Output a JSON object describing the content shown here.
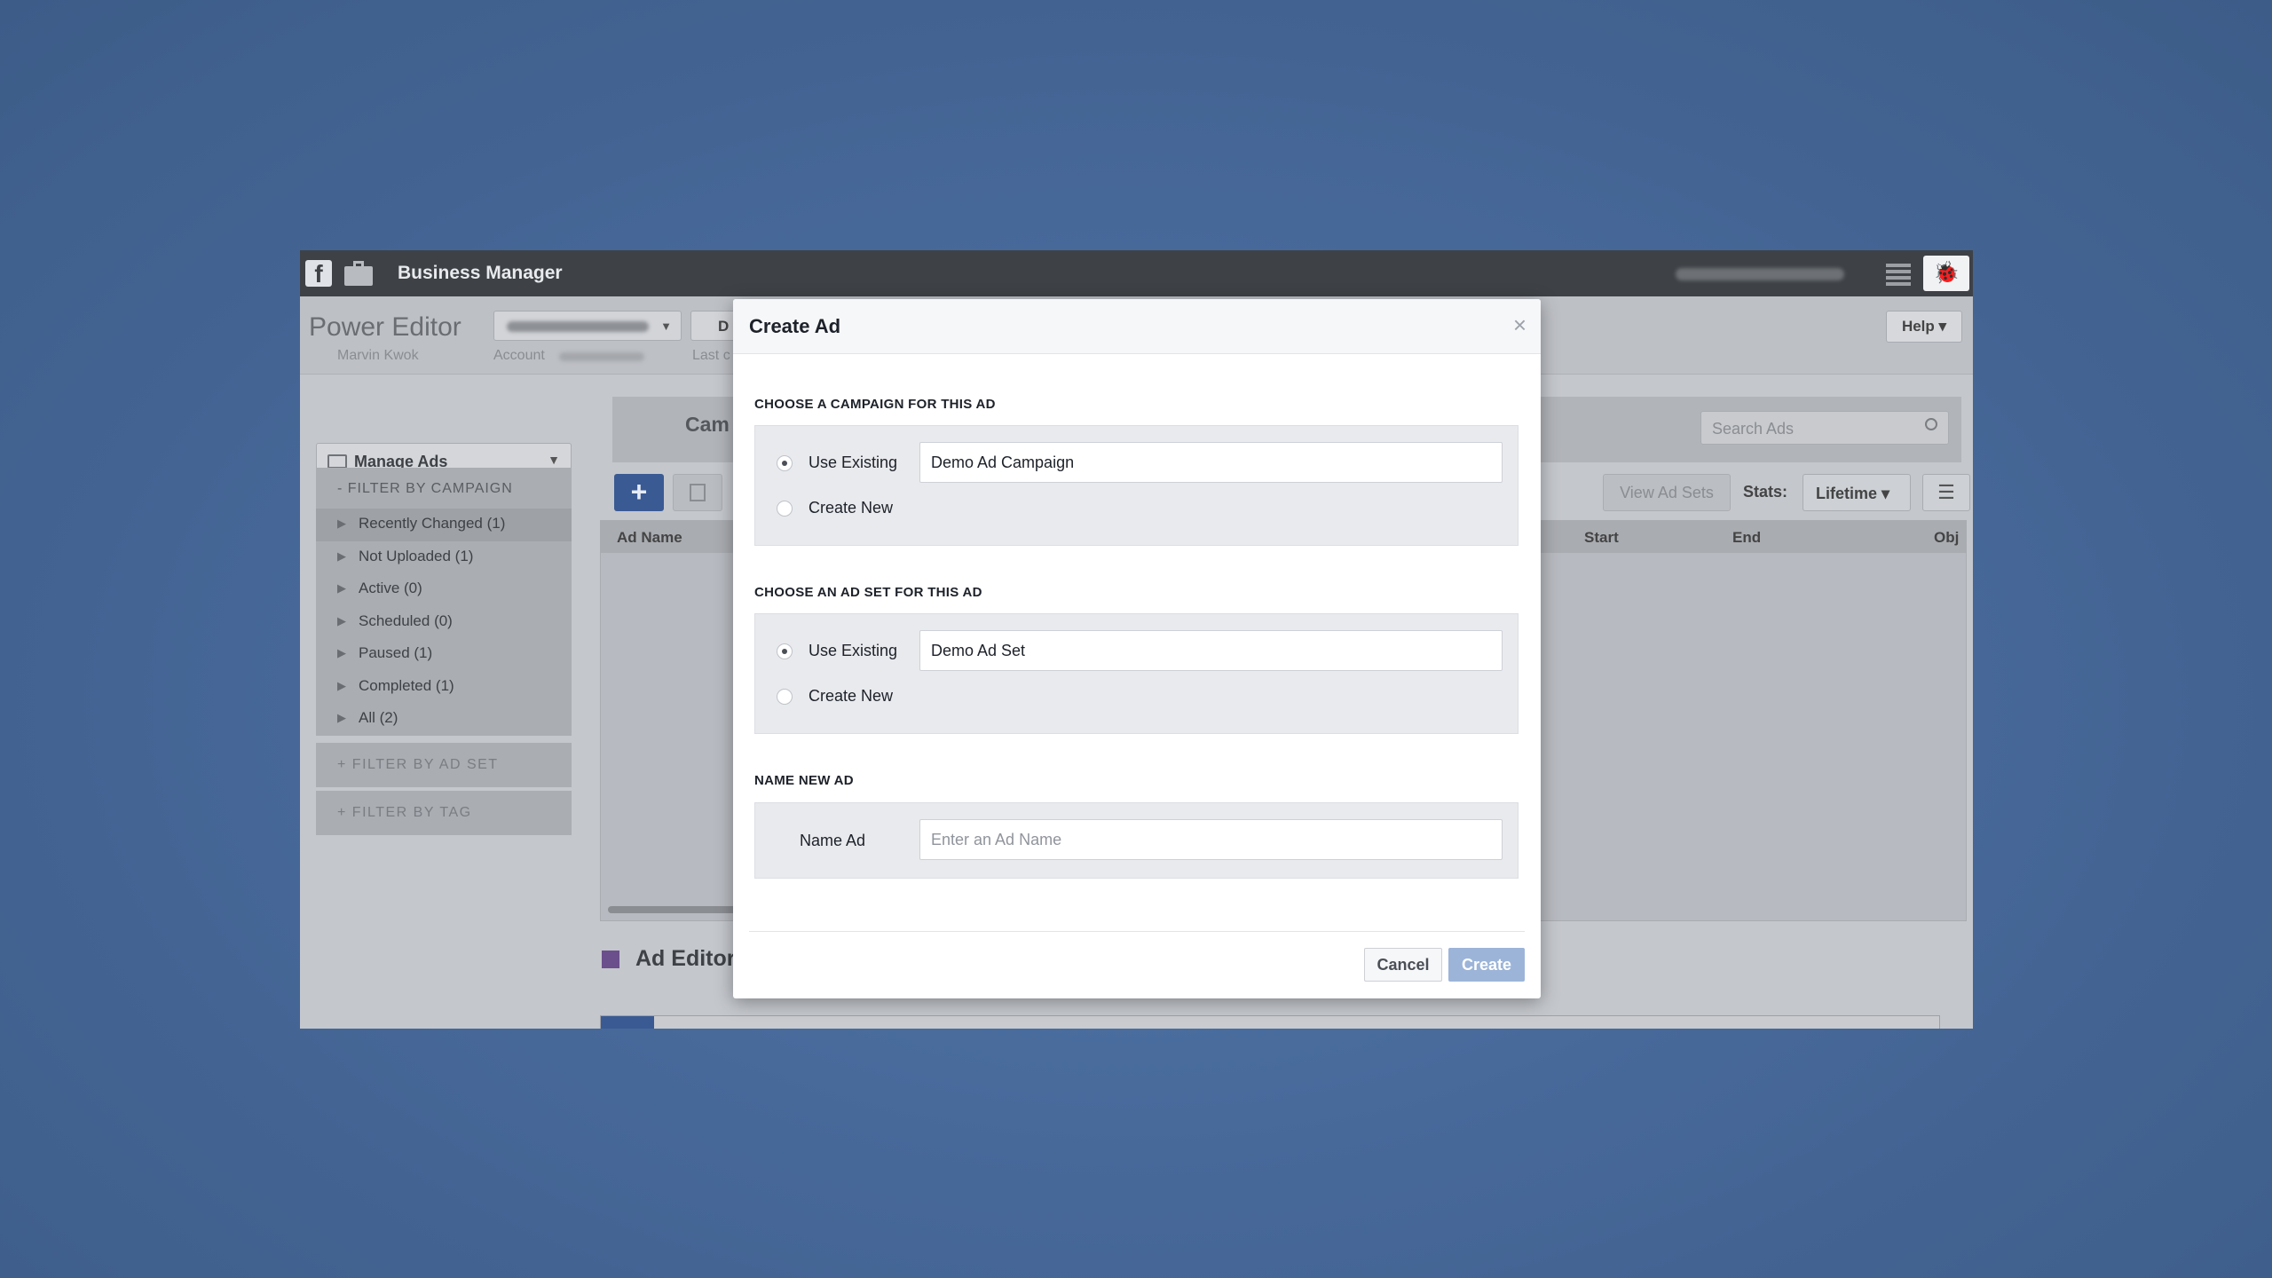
{
  "topbar": {
    "fb_icon": "facebook-icon",
    "briefcase_icon": "briefcase-icon",
    "title": "Business Manager"
  },
  "header": {
    "app_title": "Power Editor",
    "user_name": "Marvin Kwok",
    "account_label": "Account",
    "d_button": "D",
    "last_label": "Last c",
    "help_label": "Help ▾"
  },
  "sidebar": {
    "manage_ads": "Manage Ads",
    "filter_by_campaign": "- FILTER BY CAMPAIGN",
    "campaign_filters": [
      "Recently Changed (1)",
      "Not Uploaded (1)",
      "Active (0)",
      "Scheduled (0)",
      "Paused (1)",
      "Completed (1)",
      "All (2)"
    ],
    "filter_by_ad_set": "+ FILTER BY AD SET",
    "filter_by_tag": "+ FILTER BY TAG"
  },
  "main": {
    "tab_label": "Cam",
    "search_placeholder": "Search Ads",
    "add_label": "+",
    "view_ad_sets": "View Ad Sets",
    "stats_label": "Stats:",
    "stats_value": "Lifetime ▾",
    "columns": {
      "ad_name": "Ad Name",
      "start": "Start",
      "end": "End",
      "obj": "Obj"
    },
    "ad_editor_title": "Ad Editor"
  },
  "modal": {
    "title": "Create Ad",
    "close": "×",
    "campaign_section": "CHOOSE A CAMPAIGN FOR THIS AD",
    "campaign_use_existing": "Use Existing",
    "campaign_create_new": "Create New",
    "campaign_value": "Demo Ad Campaign",
    "adset_section": "CHOOSE AN AD SET FOR THIS AD",
    "adset_use_existing": "Use Existing",
    "adset_create_new": "Create New",
    "adset_value": "Demo Ad Set",
    "name_section": "NAME NEW AD",
    "name_label": "Name Ad",
    "name_placeholder": "Enter an Ad Name",
    "cancel": "Cancel",
    "create": "Create"
  },
  "colors": {
    "background": "#47699a",
    "topbar": "#3e4246",
    "primary_button": "#3a5a94",
    "create_disabled": "#9cb4d8"
  }
}
